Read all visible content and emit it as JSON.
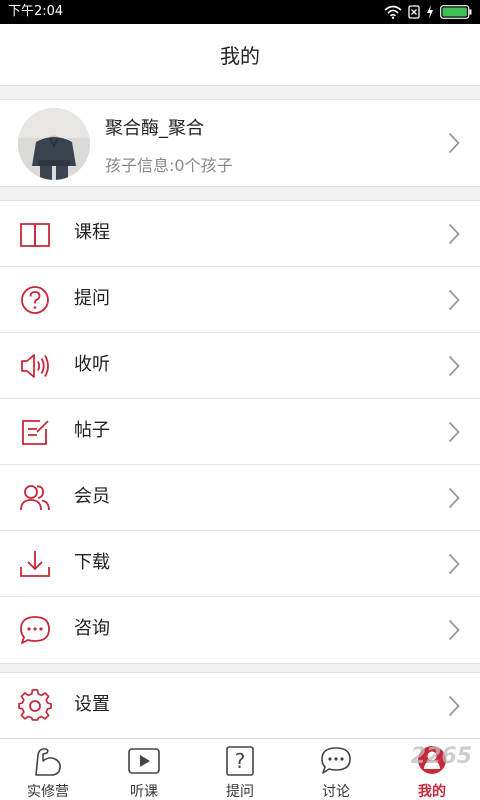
{
  "status_bar": {
    "time": "下午2:04"
  },
  "header": {
    "title": "我的"
  },
  "profile": {
    "name": "聚合酶_聚合",
    "info": "孩子信息:0个孩子"
  },
  "menu": [
    {
      "label": "课程",
      "icon": "book-icon"
    },
    {
      "label": "提问",
      "icon": "question-circle-icon"
    },
    {
      "label": "收听",
      "icon": "speaker-icon"
    },
    {
      "label": "帖子",
      "icon": "edit-note-icon"
    },
    {
      "label": "会员",
      "icon": "members-icon"
    },
    {
      "label": "下载",
      "icon": "download-icon"
    },
    {
      "label": "咨询",
      "icon": "chat-bubble-icon"
    }
  ],
  "settings": {
    "label": "设置",
    "icon": "gear-icon"
  },
  "tabs": [
    {
      "label": "实修营",
      "icon": "arm-icon"
    },
    {
      "label": "听课",
      "icon": "play-icon"
    },
    {
      "label": "提问",
      "icon": "question-box-icon"
    },
    {
      "label": "讨论",
      "icon": "chat-icon"
    },
    {
      "label": "我的",
      "icon": "profile-icon",
      "active": true
    }
  ],
  "watermark": "2265",
  "colors": {
    "accent": "#c7283a",
    "text": "#222222",
    "secondary": "#8a8a8a",
    "background": "#f2f2f2"
  }
}
